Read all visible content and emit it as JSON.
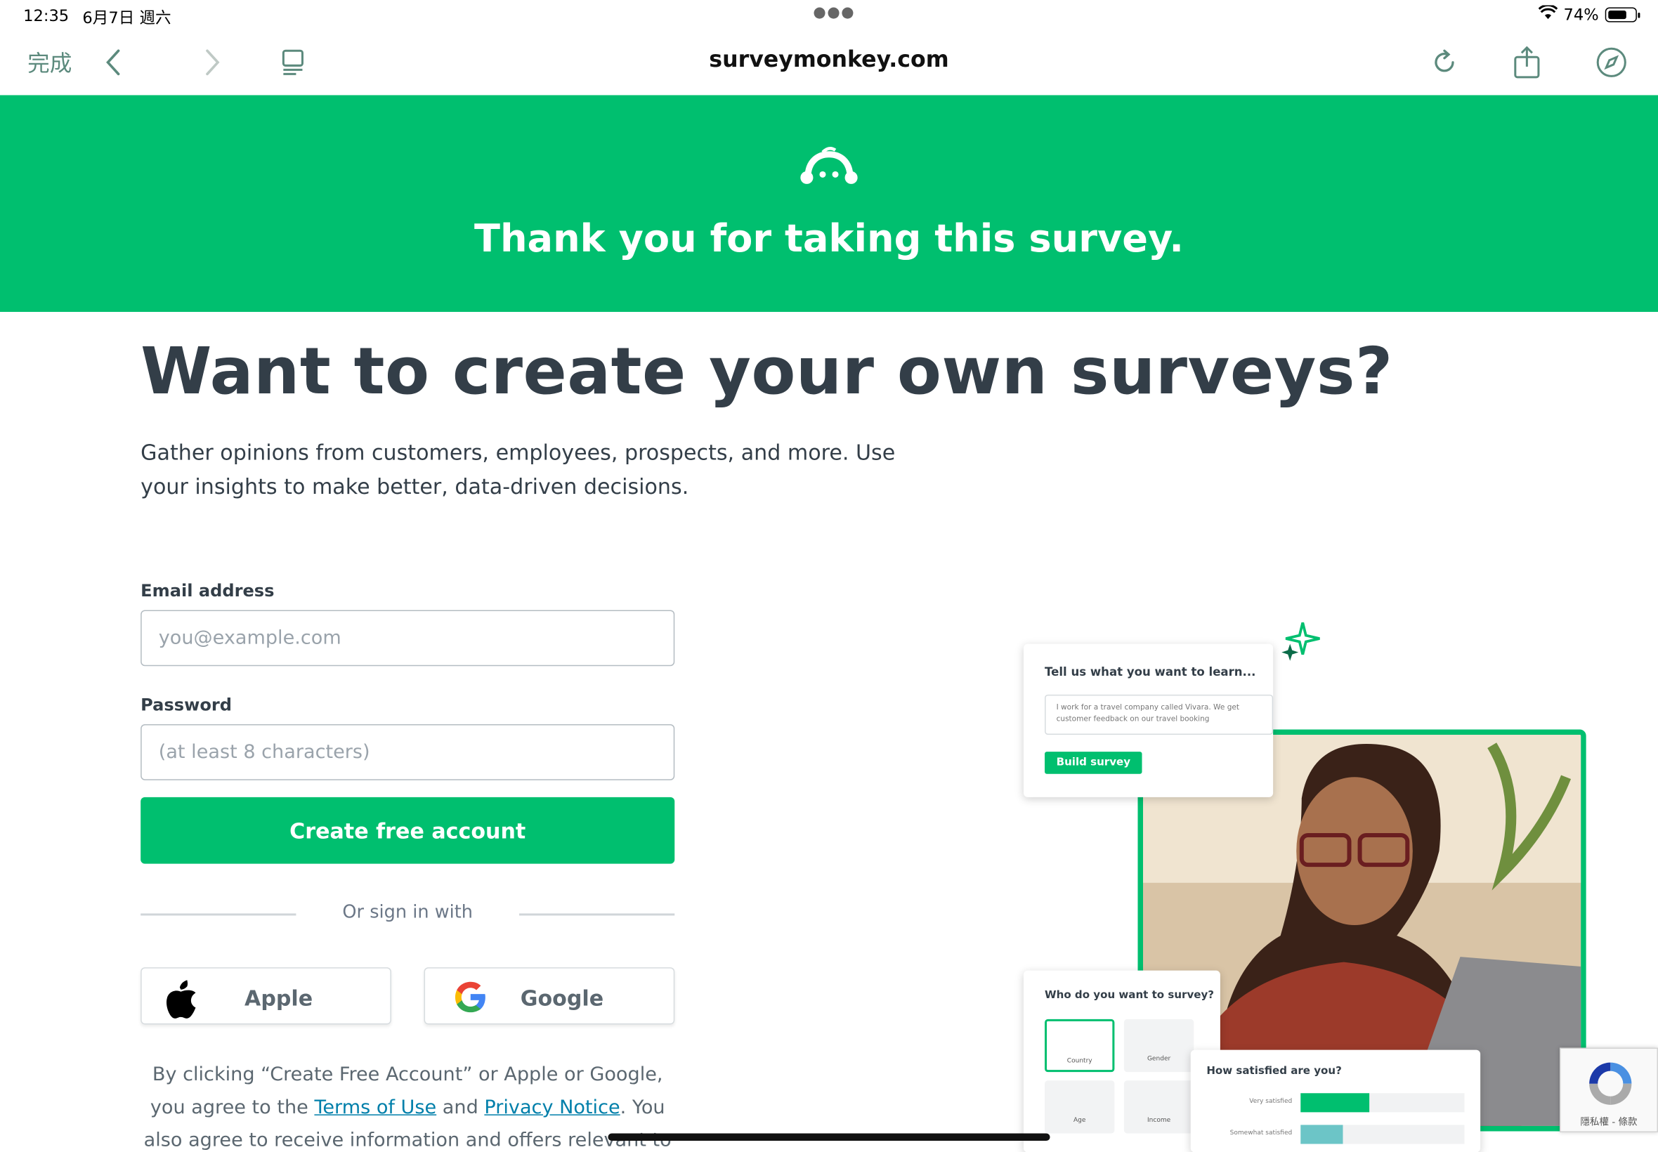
{
  "status_bar": {
    "time": "12:35",
    "date": "6月7日 週六",
    "battery": "74%",
    "battery_level": 0.74
  },
  "browser": {
    "done_label": "完成",
    "url": "surveymonkey.com"
  },
  "banner": {
    "thanks": "Thank you for taking this survey."
  },
  "main": {
    "headline": "Want to create your own surveys?",
    "subtext": "Gather opinions from customers, employees, prospects, and more. Use your insights to make better, data-driven decisions."
  },
  "form": {
    "email_label": "Email address",
    "email_placeholder": "you@example.com",
    "password_label": "Password",
    "password_placeholder": "(at least 8 characters)",
    "create_button": "Create free account",
    "or_sign_in": "Or sign in with",
    "apple_label": "Apple",
    "google_label": "Google"
  },
  "legal": {
    "part1": "By clicking “Create Free Account” or Apple or Google, you agree to the ",
    "terms": "Terms of Use",
    "and": " and ",
    "privacy": "Privacy Notice",
    "part2": ". You also agree to receive information and offers relevant to our services via"
  },
  "illustration": {
    "learn_title": "Tell us what you want to learn...",
    "learn_text": "I work for a travel company called Vivara. We get customer feedback on our travel booking",
    "build_button": "Build survey",
    "who_title": "Who do you want to survey?",
    "options": [
      "Country",
      "Gender",
      "Age",
      "Income"
    ],
    "satisfied_title": "How satisfied are you?",
    "bars": [
      {
        "label": "Very satisfied",
        "value": 0.42,
        "color": "#00bf6f"
      },
      {
        "label": "Somewhat satisfied",
        "value": 0.26,
        "color": "#6cc5c7"
      }
    ]
  },
  "recaptcha": {
    "text": "隱私權 - 條款"
  }
}
